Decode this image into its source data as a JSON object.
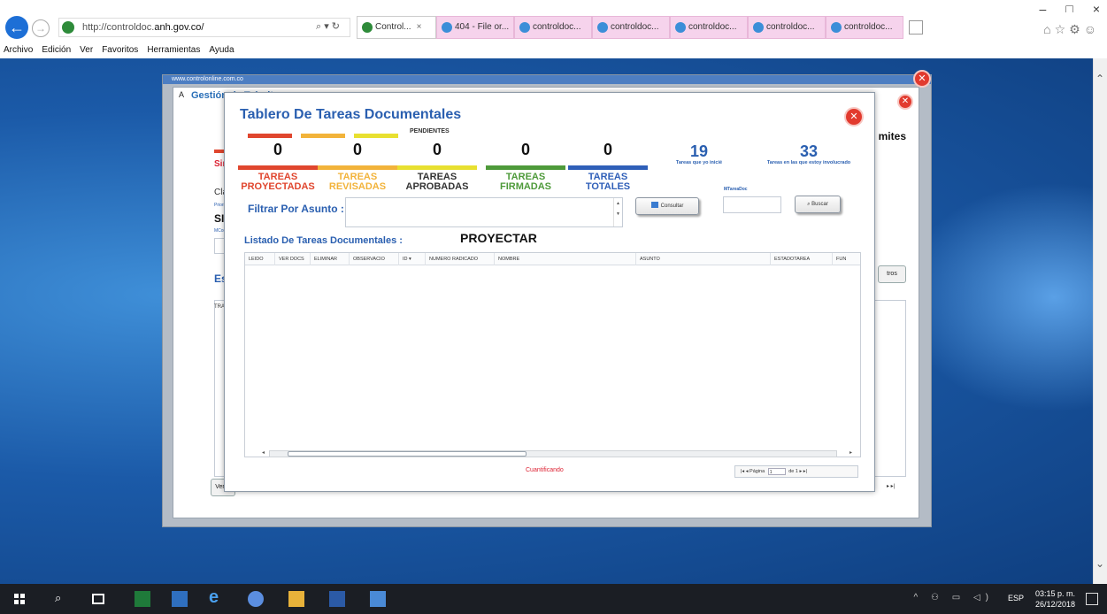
{
  "browser": {
    "window_controls": [
      "–",
      "□",
      "×"
    ],
    "url_prefix": "http://controldoc.",
    "url_host": "anh.gov.co/",
    "address_tools": "⌕ ▾ ↻",
    "tabs": [
      {
        "label": "Control...",
        "active": true
      },
      {
        "label": "404 - File or...",
        "active": false
      },
      {
        "label": "controldoc...",
        "active": false
      },
      {
        "label": "controldoc...",
        "active": false
      },
      {
        "label": "controldoc...",
        "active": false
      },
      {
        "label": "controldoc...",
        "active": false
      },
      {
        "label": "controldoc...",
        "active": false
      }
    ],
    "right_icons": "⌂☆⚙☺",
    "menu": [
      "Archivo",
      "Edición",
      "Ver",
      "Favoritos",
      "Herramientas",
      "Ayuda"
    ]
  },
  "outer": {
    "header_text": "www.controlonline.com.co",
    "close": "✕"
  },
  "gestion": {
    "title": "Gestión de Trámites",
    "right_title": "mites",
    "close": "✕",
    "sin_label": "Sin",
    "cla_label": "Cla",
    "prio_label": "Priorid",
    "sin2": "SIN",
    "mcon_label": "MCont",
    "est_label": "Est",
    "tram_label": "TRAM",
    "btn_right": "tros",
    "btn_ver": "Ver C",
    "pager_right": "▸ ▸|",
    "side_letter": "A"
  },
  "dialog": {
    "title": "Tablero De Tareas Documentales",
    "close": "✕",
    "pending_label": "PENDIENTES",
    "counters": [
      {
        "value": "0",
        "label1": "TAREAS",
        "label2": "PROYECTADAS",
        "color": "#e0462e"
      },
      {
        "value": "0",
        "label1": "TAREAS",
        "label2": "REVISADAS",
        "color": "#f2b33a"
      },
      {
        "value": "0",
        "label1": "TAREAS",
        "label2": "APROBADAS",
        "color": "#e8e030"
      },
      {
        "value": "0",
        "label1": "TAREAS",
        "label2": "FIRMADAS",
        "color": "#4e9a3a"
      },
      {
        "value": "0",
        "label1": "TAREAS",
        "label2": "TOTALES",
        "color": "#2f5fb8"
      }
    ],
    "label_colors": [
      "#e0462e",
      "#f2b33a",
      "#333333",
      "#4e9a3a",
      "#2f5fb8"
    ],
    "stat1": {
      "value": "19",
      "label": "Tareas que yo inicié"
    },
    "stat2": {
      "value": "33",
      "label": "Tareas en las que estoy involucrado"
    },
    "filter_label": "Filtrar Por Asunto :",
    "consult_button": "Consultar",
    "mini_label": "MTareaDoc",
    "search_button": "Buscar",
    "list_title": "Listado De Tareas Documentales :",
    "list_mode": "PROYECTAR",
    "columns": [
      "LEIDO",
      "VER DOCS",
      "ELIMINAR",
      "OBSERVACIO",
      "ID ▾",
      "NUMERO RADICADO",
      "NOMBRE",
      "ASUNTO",
      "ESTADOTAREA",
      "FUN"
    ],
    "status_text": "Cuantificando",
    "pager": {
      "first": "|◂",
      "prev": "◂",
      "page_label": "Página",
      "page_value": "1",
      "of_label": "de 1",
      "next": "▸",
      "last": "▸|"
    }
  },
  "taskbar": {
    "search_icon": "⌕",
    "tray": "^ ⚇ ▭ ◁)",
    "lang": "ESP",
    "time": "03:15 p. m.",
    "date": "26/12/2018"
  }
}
